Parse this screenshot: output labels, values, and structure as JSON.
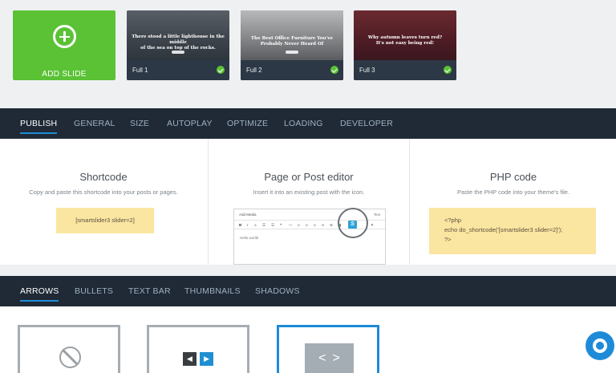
{
  "slides": {
    "add_label": "ADD SLIDE",
    "items": [
      {
        "name": "Full 1",
        "caption_line1": "There stood a little lighthouse in the middle",
        "caption_line2": "of the sea on top of the rocks."
      },
      {
        "name": "Full 2",
        "caption_line1": "The Best Office Furniture You've",
        "caption_line2": "Probably Never Heard Of"
      },
      {
        "name": "Full 3",
        "caption_line1": "Why autumn leaves turn red?",
        "caption_line2": "It's not easy being red!"
      }
    ]
  },
  "settings_tabs": [
    "PUBLISH",
    "GENERAL",
    "SIZE",
    "AUTOPLAY",
    "OPTIMIZE",
    "LOADING",
    "DEVELOPER"
  ],
  "publish": {
    "shortcode": {
      "title": "Shortcode",
      "desc": "Copy and paste this shortcode into your posts or pages.",
      "code": "[smartslider3 slider=2]"
    },
    "editor": {
      "title": "Page or Post editor",
      "desc": "Insert it into an existing post with the icon.",
      "add_media": "Add Media",
      "text_tab": "Text",
      "hello": "Hello world!"
    },
    "php": {
      "title": "PHP code",
      "desc": "Paste the PHP code into your theme's file.",
      "line1": "<?php",
      "line2": "echo do_shortcode('[smartslider3 slider=2]');",
      "line3": "?>"
    }
  },
  "controls_tabs": [
    "ARROWS",
    "BULLETS",
    "TEXT BAR",
    "THUMBNAILS",
    "SHADOWS"
  ],
  "colors": {
    "accent": "#1e8bd8",
    "add_green": "#5bc236",
    "dark_nav": "#1f2a36",
    "code_bg": "#fbe6a1"
  }
}
